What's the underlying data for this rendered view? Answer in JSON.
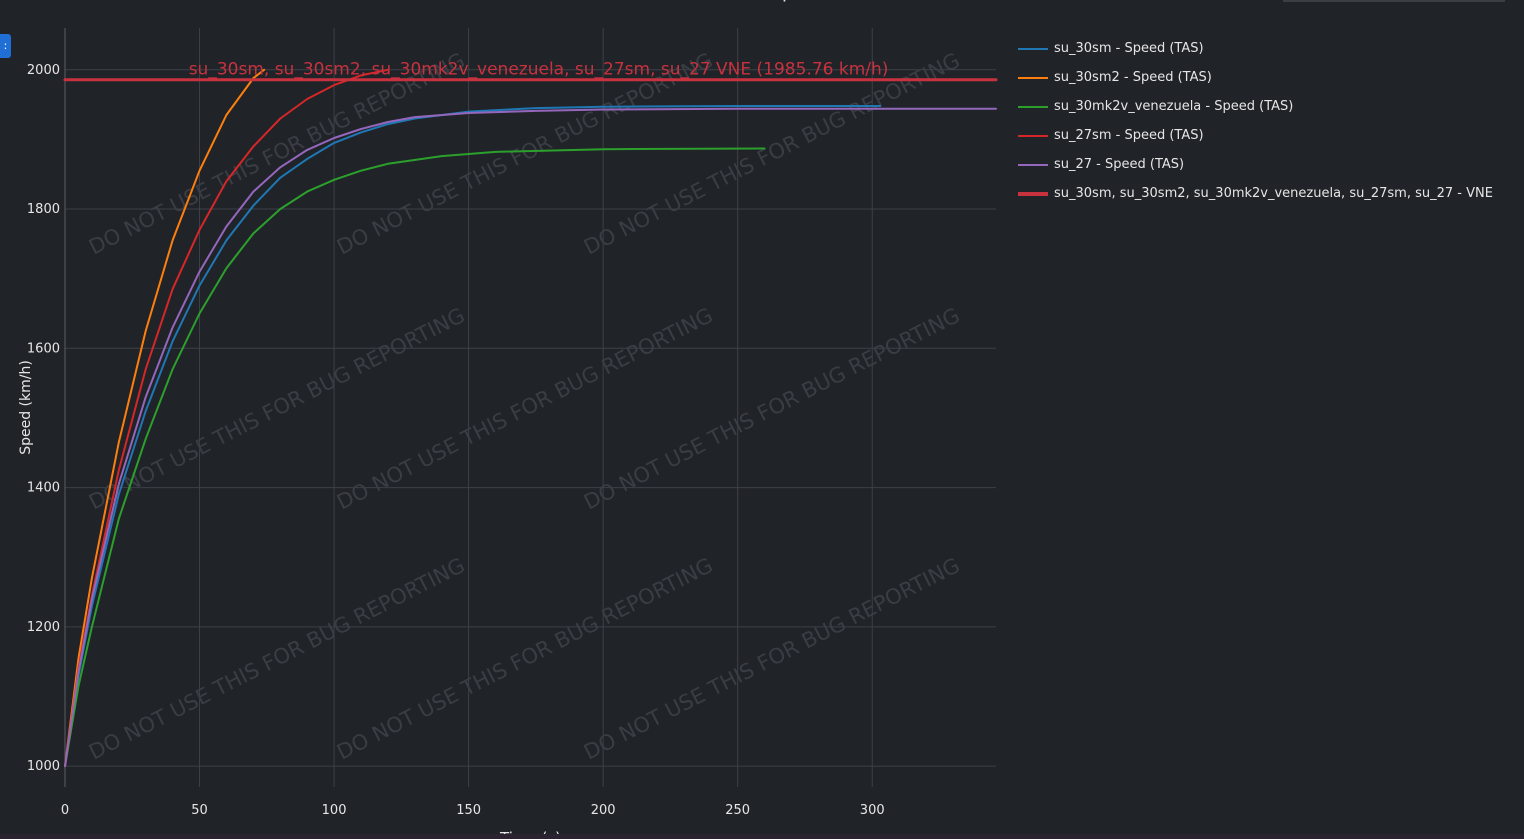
{
  "chart_data": {
    "type": "line",
    "title": "Time to Speed",
    "xlabel": "Time (s)",
    "ylabel": "Speed (km/h)",
    "xlim": [
      0,
      346
    ],
    "ylim": [
      970,
      2060
    ],
    "x_ticks": [
      0,
      50,
      100,
      150,
      200,
      250,
      300
    ],
    "y_ticks": [
      1000,
      1200,
      1400,
      1600,
      1800,
      2000
    ],
    "grid": true,
    "legend_position": "right",
    "series": [
      {
        "name": "su_30sm - Speed (TAS)",
        "color": "#1f77b4",
        "x": [
          0,
          5,
          10,
          20,
          30,
          40,
          50,
          60,
          70,
          80,
          90,
          100,
          110,
          120,
          130,
          150,
          175,
          200,
          250,
          303
        ],
        "y": [
          1000,
          1130,
          1230,
          1390,
          1510,
          1610,
          1690,
          1755,
          1805,
          1845,
          1872,
          1895,
          1910,
          1922,
          1930,
          1940,
          1945,
          1947,
          1948,
          1948
        ]
      },
      {
        "name": "su_30sm2 - Speed (TAS)",
        "color": "#ff7f0e",
        "x": [
          0,
          5,
          10,
          20,
          30,
          40,
          50,
          60,
          70,
          74
        ],
        "y": [
          1000,
          1155,
          1270,
          1465,
          1625,
          1755,
          1855,
          1935,
          1988,
          2000
        ]
      },
      {
        "name": "su_30mk2v_venezuela - Speed (TAS)",
        "color": "#2ca02c",
        "x": [
          0,
          5,
          10,
          20,
          30,
          40,
          50,
          60,
          70,
          80,
          90,
          100,
          110,
          120,
          140,
          160,
          200,
          260
        ],
        "y": [
          1000,
          1115,
          1200,
          1355,
          1470,
          1570,
          1650,
          1715,
          1765,
          1800,
          1825,
          1842,
          1855,
          1865,
          1876,
          1882,
          1886,
          1887
        ]
      },
      {
        "name": "su_27sm - Speed (TAS)",
        "color": "#d62728",
        "x": [
          0,
          5,
          10,
          20,
          30,
          40,
          50,
          60,
          70,
          80,
          90,
          100,
          110,
          120
        ],
        "y": [
          1000,
          1140,
          1245,
          1425,
          1570,
          1685,
          1770,
          1840,
          1890,
          1930,
          1958,
          1978,
          1992,
          2000
        ]
      },
      {
        "name": "su_27 - Speed (TAS)",
        "color": "#9467bd",
        "x": [
          0,
          5,
          10,
          20,
          30,
          40,
          50,
          60,
          70,
          80,
          90,
          100,
          110,
          120,
          130,
          150,
          175,
          200,
          250,
          300,
          346
        ],
        "y": [
          1000,
          1135,
          1240,
          1405,
          1530,
          1630,
          1710,
          1775,
          1825,
          1860,
          1885,
          1902,
          1915,
          1925,
          1932,
          1938,
          1941,
          1943,
          1944,
          1944,
          1944
        ]
      },
      {
        "name": "su_30sm, su_30sm2, su_30mk2v_venezuela, su_27sm, su_27 - VNE",
        "color": "#c8323f",
        "x": [
          0,
          346
        ],
        "y": [
          1985.76,
          1985.76
        ]
      }
    ],
    "annotations": [
      {
        "text": "su_30sm, su_30sm2, su_30mk2v_venezuela, su_27sm, su_27 VNE (1985.76 km/h)",
        "x": 176,
        "y": 1985.76,
        "color": "#c8323f"
      }
    ],
    "watermark": "DO NOT USE THIS FOR BUG REPORTING"
  },
  "ui": {
    "side_tab_glyph": ":"
  }
}
